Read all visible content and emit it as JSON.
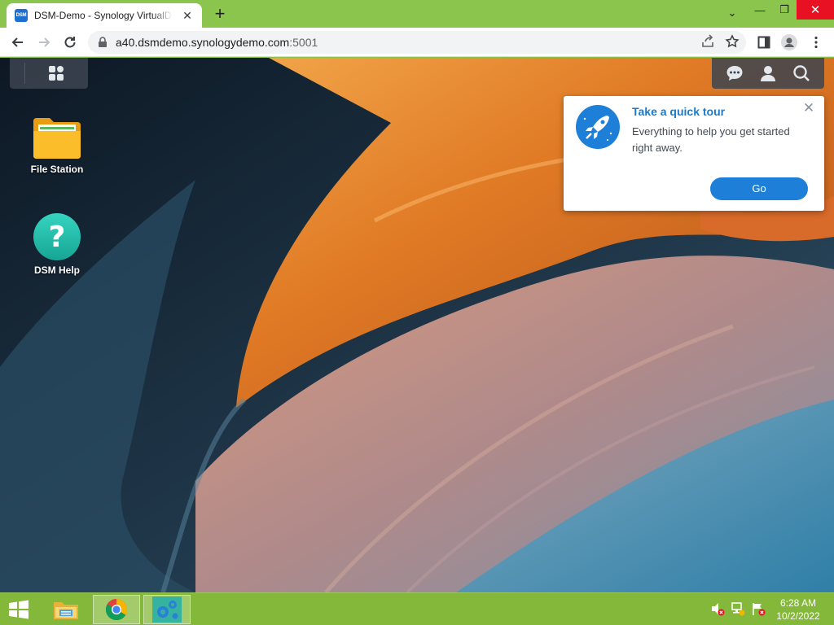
{
  "browser": {
    "tab_title": "DSM-Demo - Synology VirtualDSM",
    "tab_favicon_text": "DSM",
    "new_tab_label": "+",
    "url_host": "a40.dsmdemo.synologydemo.com",
    "url_rest": ":5001",
    "window_controls": {
      "chevron": "⌄",
      "minimize": "—",
      "maximize": "❐",
      "close": "✕"
    }
  },
  "desktop": {
    "icons": [
      {
        "label": "File Station",
        "icon": "folder-icon"
      },
      {
        "label": "DSM Help",
        "icon": "help-icon"
      }
    ],
    "help_glyph": "?"
  },
  "tour_popup": {
    "title": "Take a quick tour",
    "description": "Everything to help you get started right away.",
    "go_label": "Go",
    "close_label": "✕"
  },
  "taskbar": {
    "time": "6:28 AM",
    "date": "10/2/2022"
  },
  "colors": {
    "browser_frame": "#8cc54e",
    "tour_accent": "#1e7fd8",
    "taskbar": "#84b83a"
  }
}
